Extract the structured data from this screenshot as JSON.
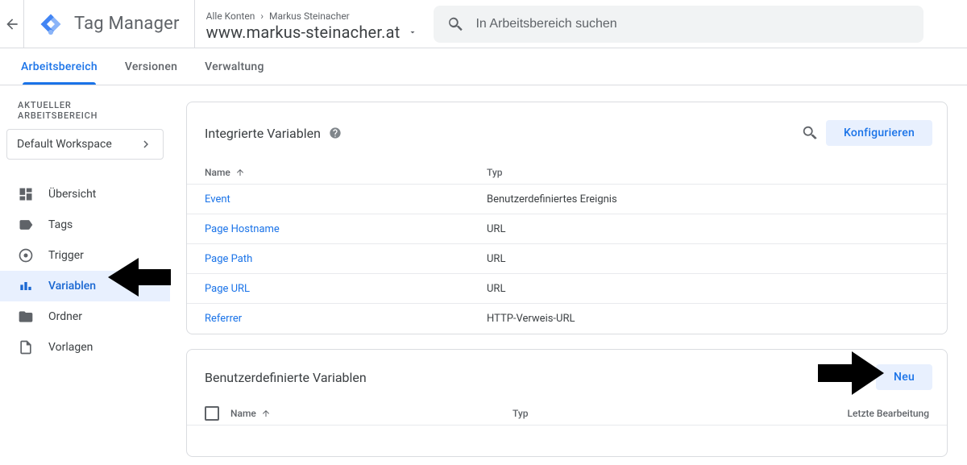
{
  "header": {
    "app_name": "Tag Manager",
    "breadcrumb_root": "Alle Konten",
    "breadcrumb_account": "Markus Steinacher",
    "container_name": "www.markus-steinacher.at",
    "search_placeholder": "In Arbeitsbereich suchen"
  },
  "tabs": [
    {
      "label": "Arbeitsbereich",
      "active": true
    },
    {
      "label": "Versionen",
      "active": false
    },
    {
      "label": "Verwaltung",
      "active": false
    }
  ],
  "sidebar": {
    "ws_label": "AKTUELLER ARBEITSBEREICH",
    "ws_name": "Default Workspace",
    "items": [
      {
        "label": "Übersicht"
      },
      {
        "label": "Tags"
      },
      {
        "label": "Trigger"
      },
      {
        "label": "Variablen"
      },
      {
        "label": "Ordner"
      },
      {
        "label": "Vorlagen"
      }
    ]
  },
  "builtin": {
    "title": "Integrierte Variablen",
    "configure_label": "Konfigurieren",
    "columns": {
      "name": "Name",
      "type": "Typ"
    },
    "rows": [
      {
        "name": "Event",
        "type": "Benutzerdefiniertes Ereignis"
      },
      {
        "name": "Page Hostname",
        "type": "URL"
      },
      {
        "name": "Page Path",
        "type": "URL"
      },
      {
        "name": "Page URL",
        "type": "URL"
      },
      {
        "name": "Referrer",
        "type": "HTTP-Verweis-URL"
      }
    ]
  },
  "custom": {
    "title": "Benutzerdefinierte Variablen",
    "new_label": "Neu",
    "columns": {
      "name": "Name",
      "type": "Typ",
      "last_edit": "Letzte Bearbeitung"
    }
  }
}
